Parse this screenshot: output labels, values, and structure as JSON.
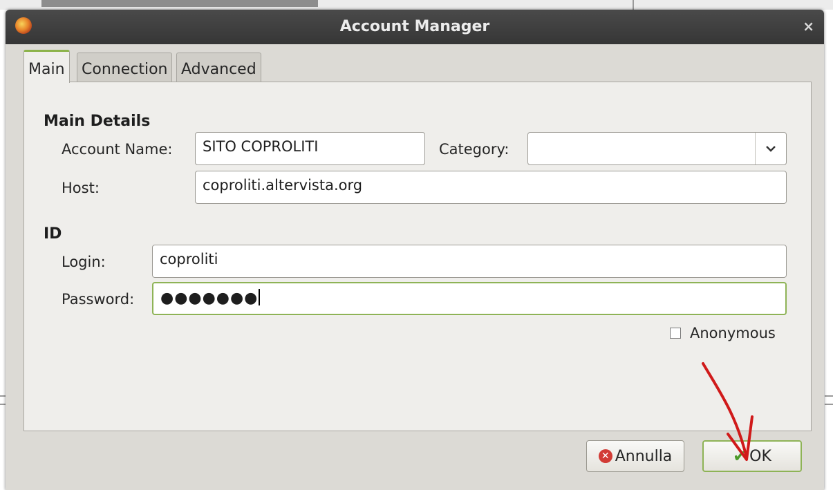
{
  "window": {
    "title": "Account Manager",
    "close_glyph": "×"
  },
  "tabs": [
    {
      "label": "Main"
    },
    {
      "label": "Connection"
    },
    {
      "label": "Advanced"
    }
  ],
  "main_details": {
    "heading": "Main Details",
    "account_name": {
      "label": "Account Name:",
      "value": "SITO COPROLITI"
    },
    "category": {
      "label": "Category:",
      "value": ""
    },
    "host": {
      "label": "Host:",
      "value": "coproliti.altervista.org"
    }
  },
  "id_section": {
    "heading": "ID",
    "login": {
      "label": "Login:",
      "value": "coproliti"
    },
    "password": {
      "label": "Password:",
      "value": "●●●●●●●"
    },
    "anonymous": {
      "label": "Anonymous",
      "checked": false
    }
  },
  "buttons": {
    "cancel": "Annulla",
    "ok": "OK"
  },
  "colors": {
    "focus_border": "#8eb356",
    "annotation_arrow": "#d01a1a"
  }
}
